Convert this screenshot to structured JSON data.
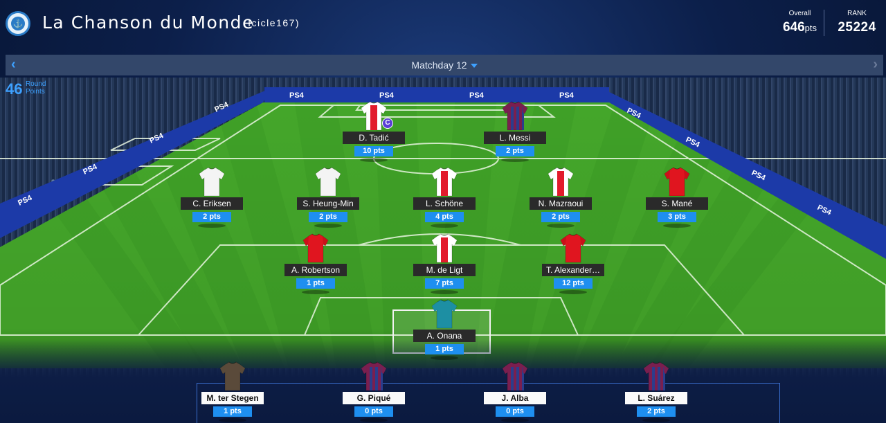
{
  "header": {
    "team_name": "La Chanson du Monde",
    "user": "(Icicle167)",
    "overall_label": "Overall",
    "overall_value": "646",
    "overall_unit": "pts",
    "rank_label": "RANK",
    "rank_value": "25224"
  },
  "matchday": {
    "prev": "‹",
    "next": "›",
    "title": "Matchday 12"
  },
  "round": {
    "points": "46",
    "label1": "Round",
    "label2": "Points"
  },
  "board_text": "PS4",
  "players": [
    {
      "id": "tadic",
      "name": "D. Tadić",
      "pts": "10 pts",
      "kit": "ajax",
      "captain": "C"
    },
    {
      "id": "messi",
      "name": "L. Messi",
      "pts": "2 pts",
      "kit": "barca"
    },
    {
      "id": "eriksen",
      "name": "C. Eriksen",
      "pts": "2 pts",
      "kit": "spurs"
    },
    {
      "id": "son",
      "name": "S. Heung-Min",
      "pts": "2 pts",
      "kit": "spurs"
    },
    {
      "id": "schone",
      "name": "L. Schöne",
      "pts": "4 pts",
      "kit": "ajax"
    },
    {
      "id": "mazraoui",
      "name": "N. Mazraoui",
      "pts": "2 pts",
      "kit": "ajax"
    },
    {
      "id": "mane",
      "name": "S. Mané",
      "pts": "3 pts",
      "kit": "liverpool"
    },
    {
      "id": "robertson",
      "name": "A. Robertson",
      "pts": "1 pts",
      "kit": "liverpool"
    },
    {
      "id": "deligt",
      "name": "M. de Ligt",
      "pts": "7 pts",
      "kit": "ajax"
    },
    {
      "id": "taa",
      "name": "T. Alexander…",
      "pts": "12 pts",
      "kit": "liverpool"
    },
    {
      "id": "onana",
      "name": "A. Onana",
      "pts": "1 pts",
      "kit": "gk"
    }
  ],
  "bench": [
    {
      "id": "terstegen",
      "name": "M. ter Stegen",
      "pts": "1 pts",
      "kit": "gkdark"
    },
    {
      "id": "pique",
      "name": "G. Piqué",
      "pts": "0 pts",
      "kit": "barca"
    },
    {
      "id": "alba",
      "name": "J. Alba",
      "pts": "0 pts",
      "kit": "barca"
    },
    {
      "id": "suarez",
      "name": "L. Suárez",
      "pts": "2 pts",
      "kit": "barca"
    }
  ],
  "colors": {
    "accent": "#1e8ff0",
    "pitch_light": "#4bb02e",
    "pitch_dark": "#3c9a24",
    "board": "#1c3aa8"
  }
}
